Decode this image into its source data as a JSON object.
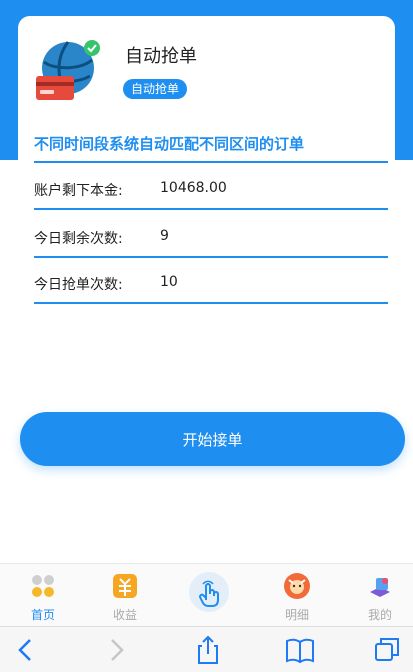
{
  "card": {
    "title": "自动抢单",
    "badge": "自动抢单",
    "subtitle": "不同时间段系统自动匹配不同区间的订单",
    "rows": [
      {
        "label": "账户剩下本金:",
        "value": "10468.00"
      },
      {
        "label": "今日剩余次数:",
        "value": "9"
      },
      {
        "label": "今日抢单次数:",
        "value": "10"
      }
    ],
    "icons": [
      "globe-icon",
      "check-badge-icon",
      "card-icon"
    ]
  },
  "start_button": {
    "label": "开始接单"
  },
  "tabbar": {
    "items": [
      {
        "label": "首页",
        "icon": "home-dots-icon",
        "active": true
      },
      {
        "label": "收益",
        "icon": "income-icon",
        "active": false
      },
      {
        "label": "",
        "icon": "tap-hand-icon",
        "active": false
      },
      {
        "label": "明细",
        "icon": "detail-icon",
        "active": false
      },
      {
        "label": "我的",
        "icon": "profile-icon",
        "active": false
      }
    ]
  },
  "browser_bar": {
    "buttons": [
      "back-icon",
      "forward-icon",
      "share-icon",
      "bookmarks-icon",
      "tabs-icon"
    ]
  },
  "colors": {
    "primary": "#1f8ef1",
    "income_tab": "#f5a623",
    "inactive_text": "#aaaaaa"
  }
}
